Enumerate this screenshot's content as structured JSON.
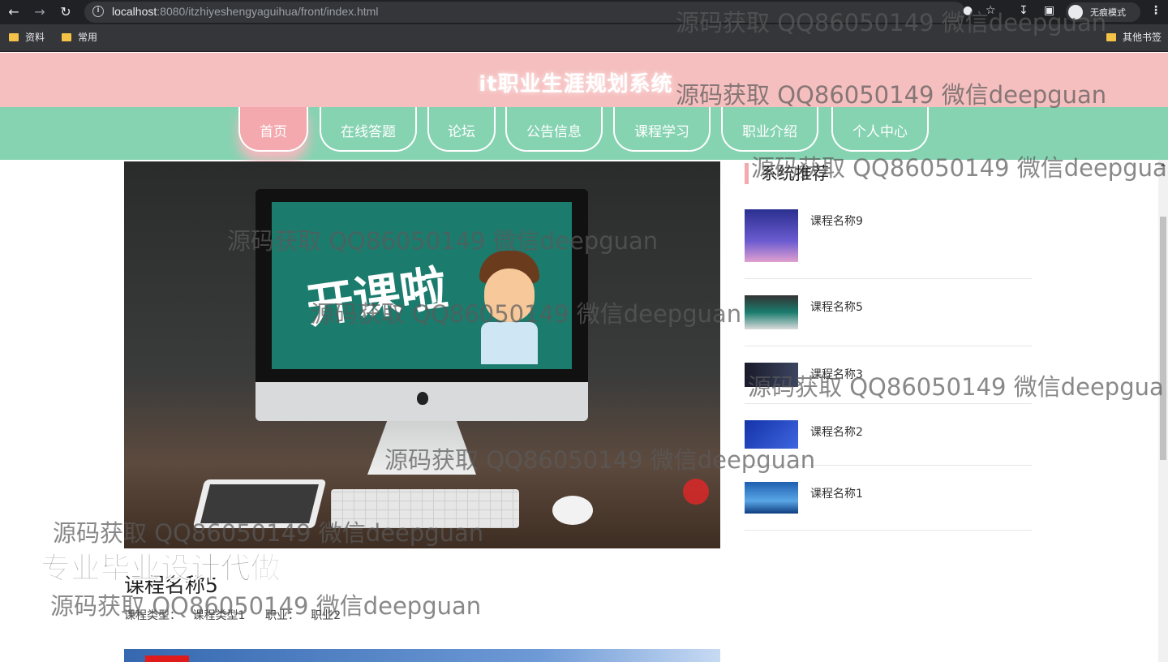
{
  "browser": {
    "url_host": "localhost",
    "url_path": ":8080/itzhiyeshengyaguihua/front/index.html",
    "incognito_label": "无痕模式",
    "bookmarks": [
      "资料",
      "常用"
    ],
    "other_bookmarks": "其他书签"
  },
  "site": {
    "title": "it职业生涯规划系统",
    "nav": [
      {
        "label": "首页",
        "active": true
      },
      {
        "label": "在线答题",
        "active": false
      },
      {
        "label": "论坛",
        "active": false
      },
      {
        "label": "公告信息",
        "active": false
      },
      {
        "label": "课程学习",
        "active": false
      },
      {
        "label": "职业介绍",
        "active": false
      },
      {
        "label": "个人中心",
        "active": false
      }
    ]
  },
  "main": {
    "screen_text": "开课啦",
    "course_title": "课程名称5",
    "course_type_label": "课程类型：",
    "course_type_value": "课程类型1",
    "career_label": "职业：",
    "career_value": "职业2"
  },
  "sidebar": {
    "title": "系统推荐",
    "items": [
      {
        "label": "课程名称9"
      },
      {
        "label": "课程名称5"
      },
      {
        "label": "课程名称3"
      },
      {
        "label": "课程名称2"
      },
      {
        "label": "课程名称1"
      }
    ]
  },
  "watermarks": {
    "text": "源码获取 QQ86050149 微信deepguan",
    "text_cut": "源码获取 QQ86050149 微信deepgua",
    "promo": "专业毕业设计代做"
  }
}
